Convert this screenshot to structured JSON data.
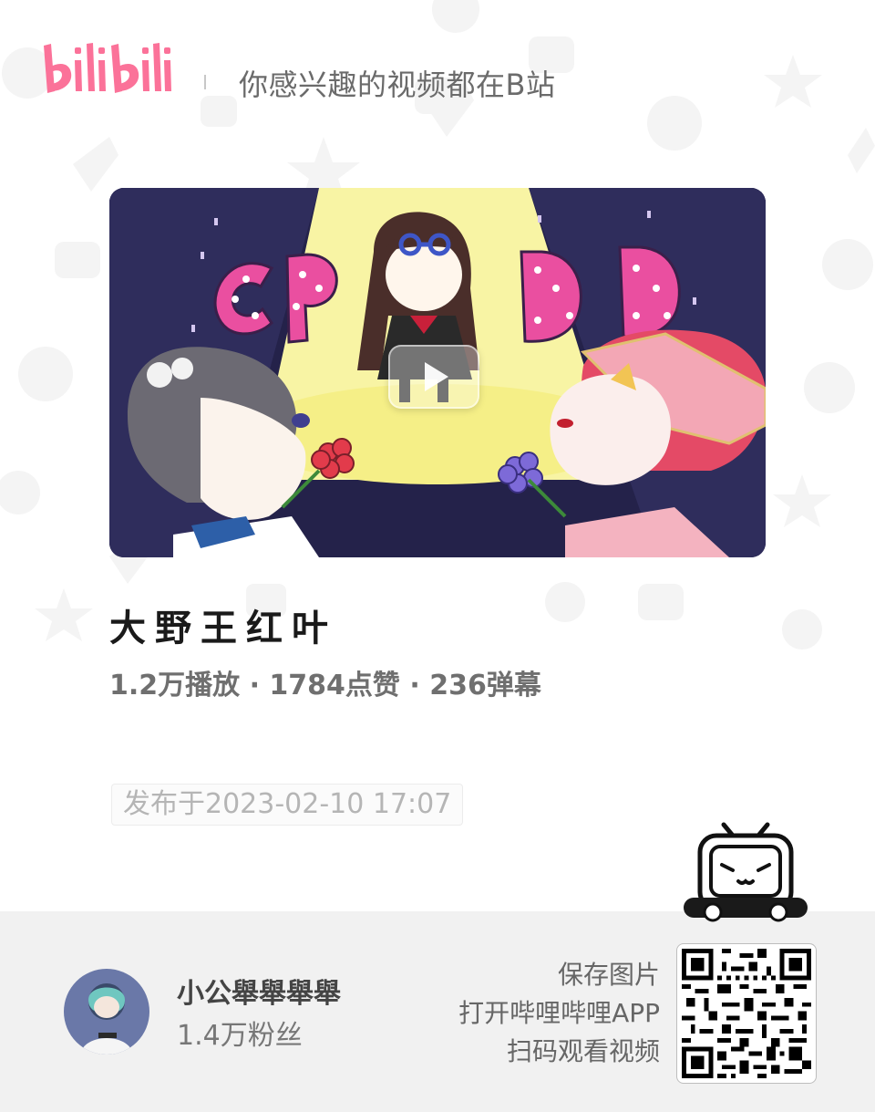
{
  "header": {
    "logo_text": "bilibili",
    "slogan": "你感兴趣的视频都在B站"
  },
  "colors": {
    "brand_pink": "#fb7299",
    "footer_bg": "#f1f1f1",
    "cover_bg": "#24224a"
  },
  "cover": {
    "art_text": [
      "C",
      "P",
      "D",
      "D"
    ],
    "play_icon": "play-icon"
  },
  "video": {
    "title": "大野王红叶",
    "stats": "1.2万播放 · 1784点赞 · 236弹幕",
    "publish_time": "发布于2023-02-10 17:07"
  },
  "uploader": {
    "name": "小公舉舉舉舉",
    "fans": "1.4万粉丝"
  },
  "qr_hints": {
    "line1": "保存图片",
    "line2": "打开哔哩哔哩APP",
    "line3": "扫码观看视频"
  },
  "icons": {
    "mascot": "tv-mascot-icon",
    "qr": "qr-code-icon"
  }
}
